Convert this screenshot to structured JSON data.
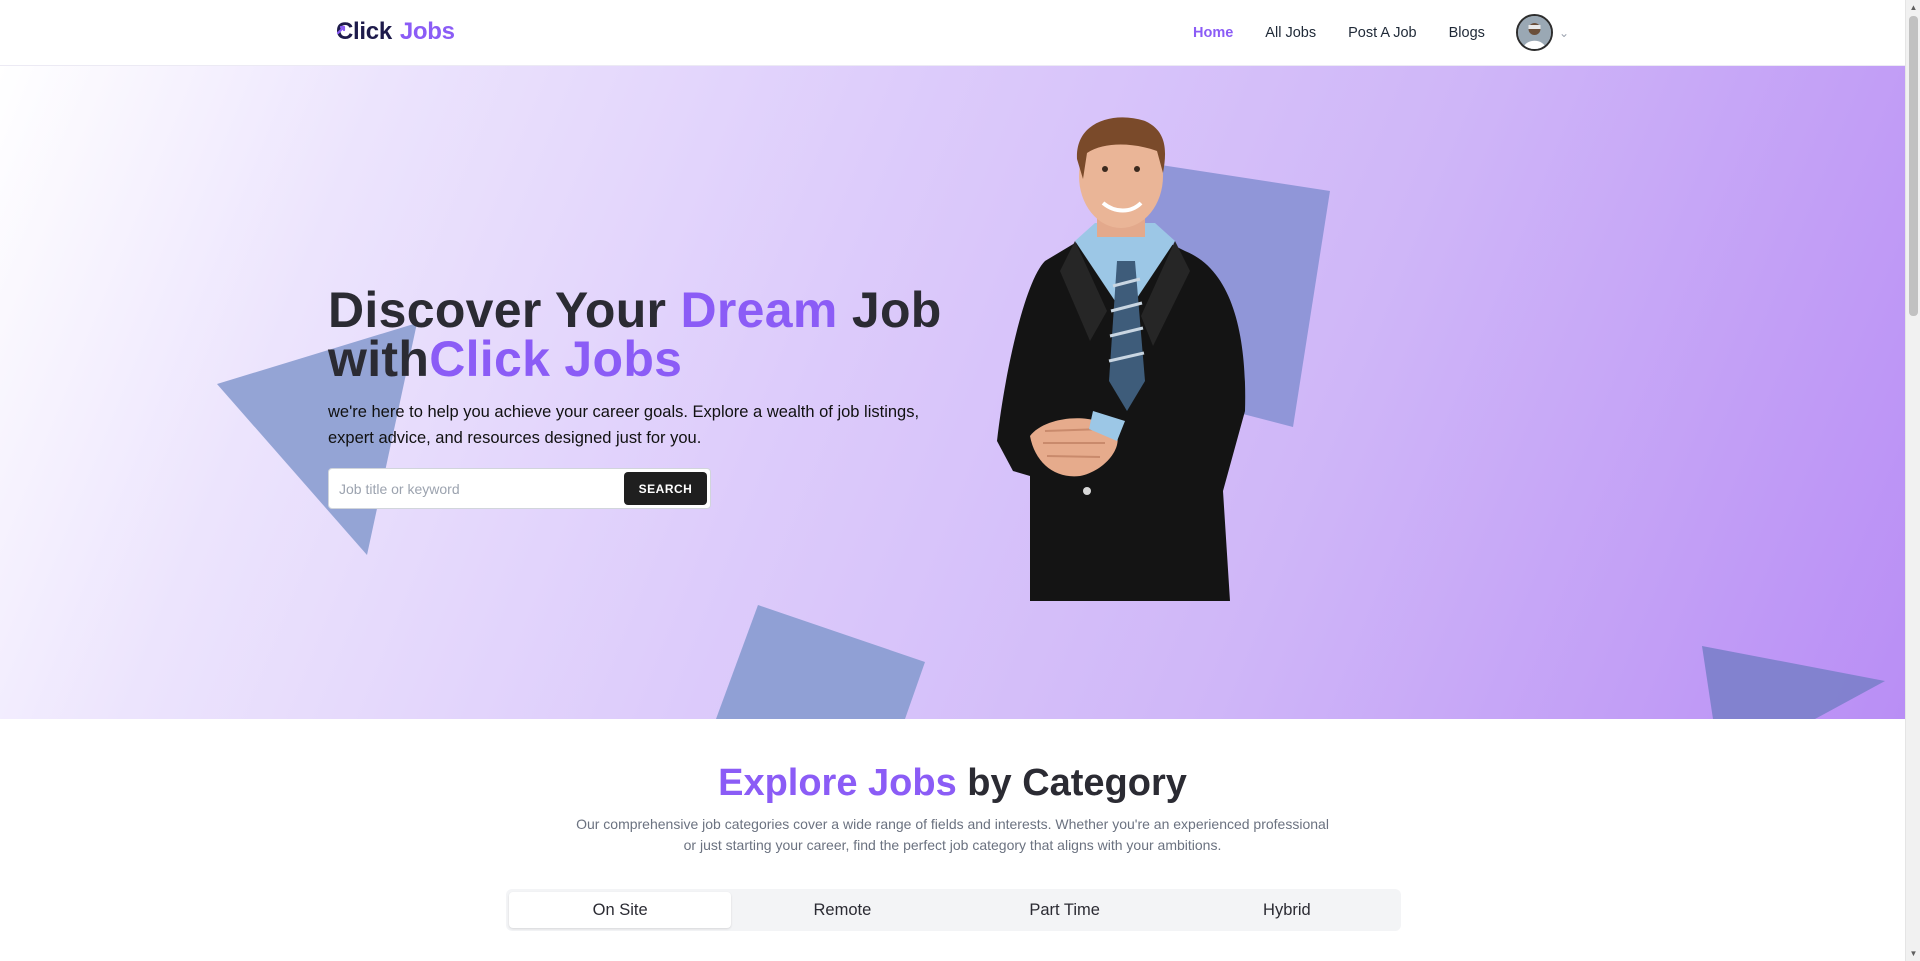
{
  "brand": {
    "logo_click": "Click",
    "logo_jobs": "Jobs",
    "accent_color": "#8b5cf6"
  },
  "nav": {
    "items": [
      {
        "label": "Home",
        "active": true
      },
      {
        "label": "All Jobs",
        "active": false
      },
      {
        "label": "Post A Job",
        "active": false
      },
      {
        "label": "Blogs",
        "active": false
      }
    ],
    "avatar_icon": "user-avatar",
    "dropdown_icon": "chevron-down-icon"
  },
  "hero": {
    "title_part1": "Discover Your ",
    "title_accent": "Dream",
    "title_part2": " Job",
    "title_line2_prefix": "with",
    "title_line2_accent": "Click Jobs",
    "description": "we're here to help you achieve your career goals. Explore a wealth of job listings, expert advice, and resources designed just for you.",
    "search_placeholder": "Job title or keyword",
    "search_value": "",
    "search_button": "SEARCH"
  },
  "categories": {
    "title_accent": "Explore Jobs",
    "title_rest": " by Category",
    "description": "Our comprehensive job categories cover a wide range of fields and interests. Whether you're an experienced professional or just starting your career, find the perfect job category that aligns with your ambitions.",
    "tabs": [
      {
        "label": "On Site",
        "active": true
      },
      {
        "label": "Remote",
        "active": false
      },
      {
        "label": "Part Time",
        "active": false
      },
      {
        "label": "Hybrid",
        "active": false
      }
    ]
  }
}
